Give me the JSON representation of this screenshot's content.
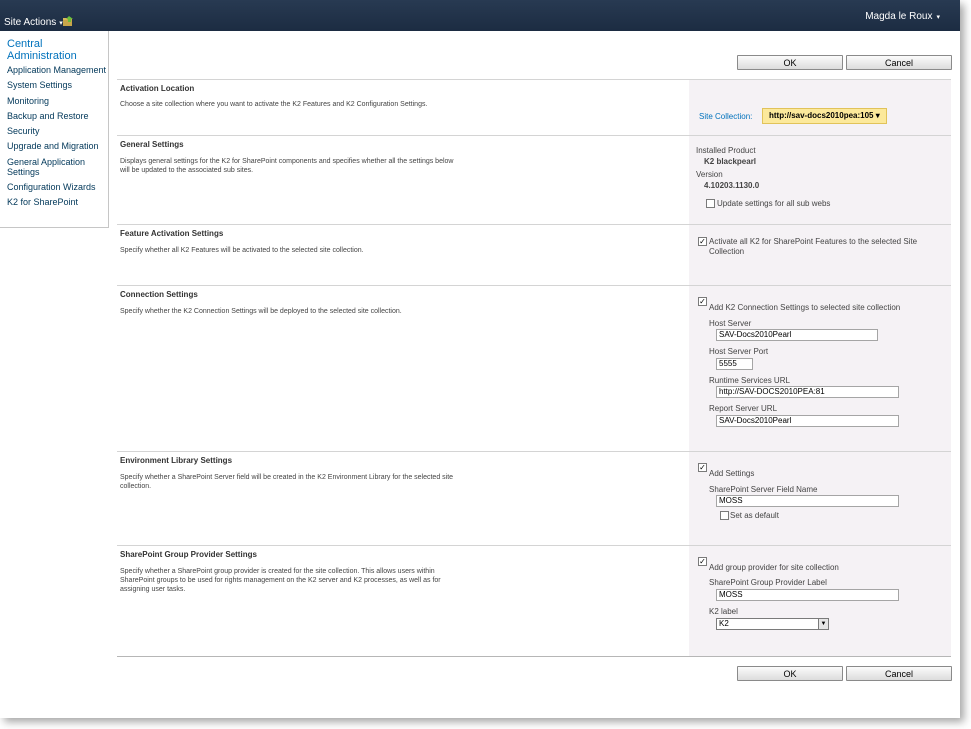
{
  "topbar": {
    "site_actions": "Site Actions",
    "caret": "▾",
    "user_name": "Magda le Roux"
  },
  "leftnav": {
    "title": "Central Administration",
    "items": [
      "Application Management",
      "System Settings",
      "Monitoring",
      "Backup and Restore",
      "Security",
      "Upgrade and Migration",
      "General Application Settings",
      "Configuration Wizards",
      "K2 for SharePoint"
    ]
  },
  "buttons": {
    "ok": "OK",
    "cancel": "Cancel"
  },
  "sections": {
    "activation": {
      "title": "Activation Location",
      "desc": "Choose a site collection where you want to activate the K2 Features and K2 Configuration Settings.",
      "site_collection_label": "Site Collection:",
      "site_collection_value": "http://sav-docs2010pea:105 ▾"
    },
    "general": {
      "title": "General Settings",
      "desc": "Displays general settings for the K2 for SharePoint components and specifies whether all the settings below will be updated to the associated sub sites.",
      "installed_product_label": "Installed Product",
      "installed_product_value": "K2 blackpearl",
      "version_label": "Version",
      "version_value": "4.10203.1130.0",
      "update_sub_webs_label": "Update settings for all sub webs",
      "update_sub_webs_checked": false
    },
    "feature": {
      "title": "Feature Activation Settings",
      "desc": "Specify whether all K2 Features will be activated to the selected site collection.",
      "activate_label": "Activate all K2 for SharePoint Features to the selected Site Collection",
      "activate_checked": true
    },
    "connection": {
      "title": "Connection Settings",
      "desc": "Specify whether the K2 Connection Settings will be deployed to the selected site collection.",
      "add_label": "Add K2 Connection Settings to selected site collection",
      "add_checked": true,
      "host_server_label": "Host Server",
      "host_server_value": "SAV-Docs2010Pearl",
      "host_port_label": "Host Server Port",
      "host_port_value": "5555",
      "runtime_label": "Runtime Services URL",
      "runtime_value": "http://SAV-DOCS2010PEA:81",
      "report_label": "Report Server URL",
      "report_value": "SAV-Docs2010Pearl"
    },
    "environment": {
      "title": "Environment Library Settings",
      "desc": "Specify whether a SharePoint Server field will be created in the K2 Environment Library for the selected site collection.",
      "add_label": "Add Settings",
      "add_checked": true,
      "field_name_label": "SharePoint Server Field Name",
      "field_name_value": "MOSS",
      "default_label": "Set as default",
      "default_checked": false
    },
    "group_provider": {
      "title": "SharePoint Group Provider Settings",
      "desc": "Specify whether a SharePoint group provider is created for the site collection. This allows users within SharePoint groups to be used for rights management on the K2 server and K2 processes, as well as for assigning user tasks.",
      "add_label": "Add group provider for site collection",
      "add_checked": true,
      "provider_label_label": "SharePoint Group Provider Label",
      "provider_label_value": "MOSS",
      "k2_label_label": "K2 label",
      "k2_label_value": "K2"
    }
  },
  "colors": {
    "topbar": "#1c2c42",
    "nav_title": "#0072bc",
    "right_panel": "#f5f2f5",
    "site_collection_bg": "#fce99b"
  }
}
